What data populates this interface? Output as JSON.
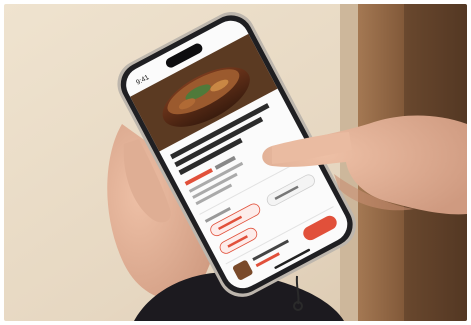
{
  "scene": {
    "colors": {
      "wall": "#e9dcc8",
      "wood": "#8a6140",
      "skin": "#e3b49b",
      "sleeve": "#1c1a1f",
      "phone_frame": "#c9c3bb",
      "screen": "#fbfbfb",
      "accent": "#e1503a"
    }
  },
  "phone_screen": {
    "status_time": "9:41",
    "product_title": "",
    "product_price": "",
    "section_label": "",
    "button_label": ""
  }
}
